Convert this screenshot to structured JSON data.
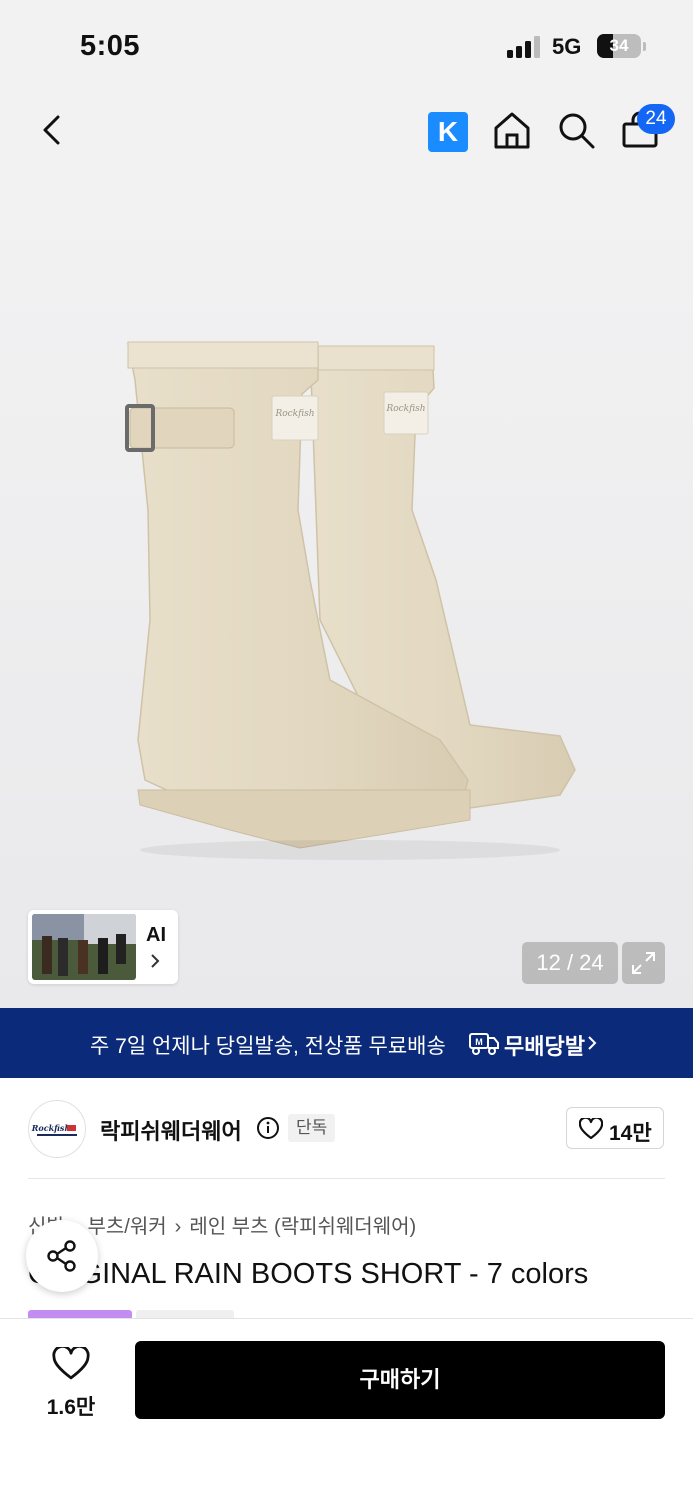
{
  "status_bar": {
    "time": "5:05",
    "network": "5G",
    "battery": "34"
  },
  "header": {
    "k_label": "K",
    "cart_count": "24"
  },
  "gallery": {
    "ai_label": "AI",
    "counter": "12 / 24"
  },
  "banner": {
    "message": "주 7일 언제나 당일발송, 전상품 무료배송",
    "brand": "무배당발"
  },
  "store": {
    "name": "락피쉬웨더웨어",
    "badge": "단독",
    "likes": "14만"
  },
  "breadcrumbs": [
    "신발",
    "부츠/워커",
    "레인 부츠 (락피쉬웨더웨어)"
  ],
  "product": {
    "title": "ORIGINAL RAIN BOOTS SHORT - 7 colors"
  },
  "bottom_bar": {
    "wish_count": "1.6만",
    "buy_label": "구매하기"
  },
  "colors": {
    "banner_bg": "#0b2b7a",
    "cart_badge": "#1466f5",
    "k_icon": "#1a8cff",
    "boot": "#e6dcc6"
  }
}
